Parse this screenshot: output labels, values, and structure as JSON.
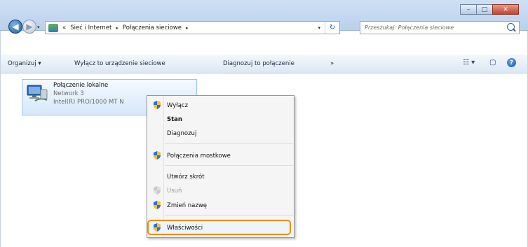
{
  "window": {
    "caption_buttons": {
      "minimize": "–",
      "maximize": "□",
      "close": "✕"
    }
  },
  "nav": {
    "back_glyph": "◀",
    "forward_glyph": "▶",
    "dropdown_glyph": "▾"
  },
  "address": {
    "prefix": "«",
    "crumbs": [
      "Sieć i Internet",
      "Połączenia sieciowe"
    ],
    "separator": "▸",
    "dropdown_glyph": "▾",
    "refresh_glyph": "↻"
  },
  "search": {
    "placeholder": "Przeszukaj: Połączenia sieciowe"
  },
  "commandbar": {
    "organize": "Organizuj",
    "organize_arrow": "▾",
    "disable_device": "Wyłącz to urządzenie sieciowe",
    "diagnose_connection": "Diagnozuj to połączenie",
    "more": "»",
    "views_glyph": "☷ ▾",
    "preview_glyph": "▢",
    "help_glyph": "?"
  },
  "connection": {
    "name": "Połączenie lokalne",
    "network": "Network 3",
    "adapter": "Intel(R) PRO/1000 MT N"
  },
  "context_menu": {
    "items": [
      {
        "label": "Wyłącz",
        "shield": true,
        "disabled": false,
        "bold": false
      },
      {
        "label": "Stan",
        "shield": false,
        "disabled": false,
        "bold": true
      },
      {
        "label": "Diagnozuj",
        "shield": false,
        "disabled": false,
        "bold": false
      },
      {
        "label": "Połączenia mostkowe",
        "shield": true,
        "disabled": false,
        "bold": false
      },
      {
        "label": "Utwórz skrót",
        "shield": false,
        "disabled": false,
        "bold": false
      },
      {
        "label": "Usuń",
        "shield": true,
        "disabled": true,
        "bold": false
      },
      {
        "label": "Zmień nazwę",
        "shield": true,
        "disabled": false,
        "bold": false
      },
      {
        "label": "Właściwości",
        "shield": true,
        "disabled": false,
        "bold": false,
        "highlighted": true
      }
    ]
  },
  "colors": {
    "highlight_outline": "#f08c00",
    "selection_fill": "#d6e8fa",
    "titlebar": "#c5daf0"
  }
}
